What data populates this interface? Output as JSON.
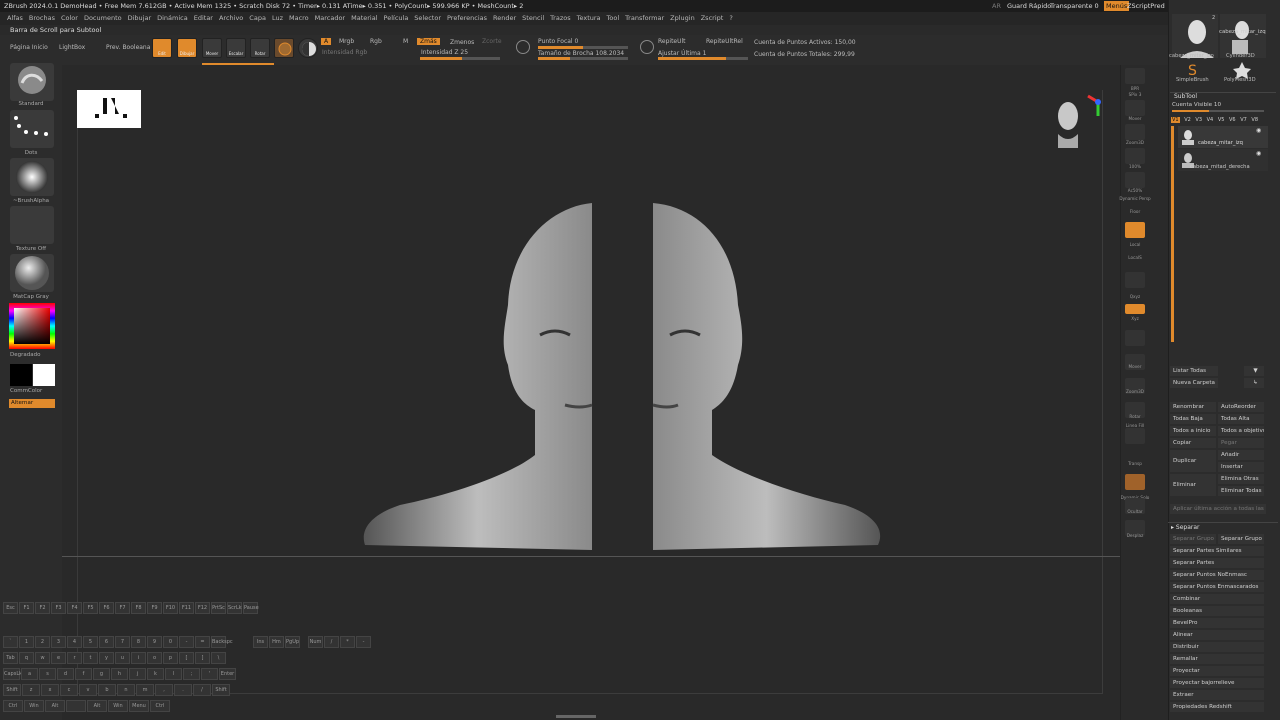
{
  "titlebar": {
    "text": "ZBrush 2024.0.1    DemoHead   • Free Mem 7.612GB • Active Mem 1325 • Scratch Disk 72 • Timer▸ 0.131 ATime▸ 0.351 • PolyCount▸ 599.966 KP • MeshCount▸ 2",
    "ar": "AR",
    "quicksave": "Guard Rápido",
    "transparent": "Transparente 0",
    "menus": "Menús",
    "zscript": "ZScriptPred"
  },
  "menubar": [
    "Alfas",
    "Brochas",
    "Color",
    "Documento",
    "Dibujar",
    "Dinámica",
    "Editar",
    "Archivo",
    "Capa",
    "Luz",
    "Macro",
    "Marcador",
    "Material",
    "Película",
    "Selector",
    "Preferencias",
    "Render",
    "Stencil",
    "Trazos",
    "Textura",
    "Tool",
    "Transformar",
    "Zplugin",
    "Zscript",
    "?"
  ],
  "scroll_label": "Barra de Scroll para Subtool",
  "shelf": {
    "home": "Página Inicio",
    "lightbox": "LightBox",
    "prev_boolean": "Prev. Booleana",
    "edit": "Edit",
    "draw": "Dibujar",
    "move": "Mover",
    "scale": "Escalar",
    "rotate": "Rotar",
    "a": "A",
    "mrgb": "Mrgb",
    "rgb": "Rgb",
    "m": "M",
    "zadd": "Zmás",
    "zsub": "Zmenos",
    "zcut": "Zcorte",
    "rgb_intensity": "Intensidad Rgb",
    "z_intensity": "Intensidad Z 25",
    "focal": "Punto Focal 0",
    "brush_size": "Tamaño de Brocha 108.2034",
    "repeat_ult": "RepiteUlt",
    "repeat_ult_rel": "RepiteUltRel",
    "adjust_last": "Ajustar Última 1",
    "active_points": "Cuenta de Puntos Activos: 150,00",
    "total_points": "Cuenta de Puntos Totales: 299,99"
  },
  "left": {
    "standard": "Standard",
    "dots": "Dots",
    "brushalpha": "~BrushAlpha",
    "texture_off": "Texture Off",
    "matcap": "MatCap Gray",
    "gradient": "Degradado",
    "swatch": "CommColor",
    "alternate": "Alternar"
  },
  "right_strip": [
    "BPR",
    "SPix 3",
    "Mover",
    "Zoom3D",
    "100%",
    "Ac50%",
    "Dynamic Persp",
    "Floor",
    "Local",
    "LocalS",
    "Qxyz",
    "Xyz",
    "Mover",
    "Zoom3D",
    "Rotar",
    "Linea Fill",
    "Transp",
    "Dynamic Solo",
    "Ocultar",
    "Desplaz"
  ],
  "rightpanel": {
    "tool_labels": [
      "cabeza_mitar_izo",
      "Cylinder3D",
      "SimpleBrush",
      "PolyMesh3D"
    ],
    "tool_top": "cabeza_mitar_izq",
    "tool_count": "2",
    "subtool_title": "SubTool",
    "visible_count": "Cuenta Visible 10",
    "tabs": [
      "V1",
      "V2",
      "V3",
      "V4",
      "V5",
      "V6",
      "V7",
      "V8"
    ],
    "subtools": [
      "cabeza_mitar_izq",
      "cabeza_mitad_derecha"
    ],
    "buttons": [
      {
        "a": "Listar Todas",
        "b": ""
      },
      {
        "a": "Nueva Carpeta",
        "b": ""
      },
      {
        "a": "Renombrar",
        "b": "AutoReorder"
      },
      {
        "a": "Todas Baja",
        "b": "Todas Alta"
      },
      {
        "a": "Todos a inicio",
        "b": "Todos a objetivo"
      },
      {
        "a": "Copiar",
        "b": "Pegar"
      }
    ],
    "duplicate": "Duplicar",
    "add": "Añadir",
    "insert": "Insertar",
    "delete": "Eliminar",
    "delete_others": "Elimina Otras",
    "delete_all": "Eliminar Todas",
    "apply_last": "Aplicar última acción a todas las",
    "separate_header": "Separar",
    "separate": [
      {
        "a": "Separar Grupo",
        "b": "Separar Grupo"
      },
      {
        "a": "Separar Partes Similares",
        "b": ""
      },
      {
        "a": "Separar Partes",
        "b": ""
      },
      {
        "a": "Separar Puntos NoEnmasc",
        "b": ""
      },
      {
        "a": "Separar Puntos Enmascarados",
        "b": ""
      }
    ],
    "list": [
      "Combinar",
      "Booleanas",
      "BevelPro",
      "Alinear",
      "Distribuir",
      "Remallar",
      "Proyectar",
      "Proyectar bajorrelieve",
      "Extraer",
      "Propiedades Redshift"
    ]
  },
  "keyboard": {
    "fkeys": [
      "Esc",
      "F1",
      "F2",
      "F3",
      "F4",
      "F5",
      "F6",
      "F7",
      "F8",
      "F9",
      "F10",
      "F11",
      "F12",
      "PrtSc",
      "ScrLk",
      "Pause"
    ],
    "row1": [
      "`",
      "1",
      "2",
      "3",
      "4",
      "5",
      "6",
      "7",
      "8",
      "9",
      "0",
      "-",
      "=",
      "Backspc"
    ],
    "row2": [
      "Tab",
      "q",
      "w",
      "e",
      "r",
      "t",
      "y",
      "u",
      "i",
      "o",
      "p",
      "[",
      "]",
      "\\"
    ],
    "row3": [
      "CapsLk",
      "a",
      "s",
      "d",
      "f",
      "g",
      "h",
      "j",
      "k",
      "l",
      ";",
      "'",
      "Enter"
    ],
    "row4": [
      "Shift",
      "z",
      "x",
      "c",
      "v",
      "b",
      "n",
      "m",
      ",",
      ".",
      "/",
      "Shift"
    ],
    "row5": [
      "Ctrl",
      "Win",
      "Alt",
      "",
      "Alt",
      "Win",
      "Menu",
      "Ctrl"
    ],
    "nav": [
      "Ins",
      "Hm",
      "PgUp",
      "Del",
      "End",
      "PgDn",
      "↑",
      "←",
      "↓",
      "→"
    ],
    "numpad": [
      "Num",
      "/",
      "*",
      "-",
      "7",
      "8",
      "9",
      "+",
      "4",
      "5",
      "6",
      "1",
      "2",
      "3",
      "0",
      "."
    ]
  },
  "colors": {
    "accent": "#e08a2c",
    "bg": "#2a2a2a",
    "panel": "#2c2c2c"
  }
}
